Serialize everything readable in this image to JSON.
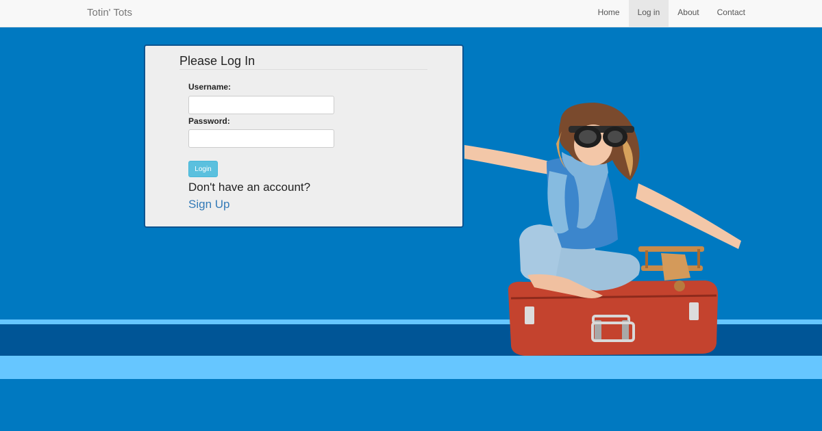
{
  "navbar": {
    "brand": "Totin' Tots",
    "items": [
      {
        "label": "Home",
        "active": false
      },
      {
        "label": "Log in",
        "active": true
      },
      {
        "label": "About",
        "active": false
      },
      {
        "label": "Contact",
        "active": false
      }
    ]
  },
  "login": {
    "title": "Please Log In",
    "username_label": "Username:",
    "username_value": "",
    "password_label": "Password:",
    "password_value": "",
    "login_button": "Login",
    "no_account_text": "Don't have an account?",
    "signup_link": "Sign Up"
  },
  "colors": {
    "background": "#0079c1",
    "stripe_light": "#66c6ff",
    "stripe_dark": "#005596",
    "panel_border": "#0d5490",
    "login_button": "#5bc0de",
    "link": "#337ab7"
  },
  "hero_image": "child-aviator-on-red-suitcase"
}
